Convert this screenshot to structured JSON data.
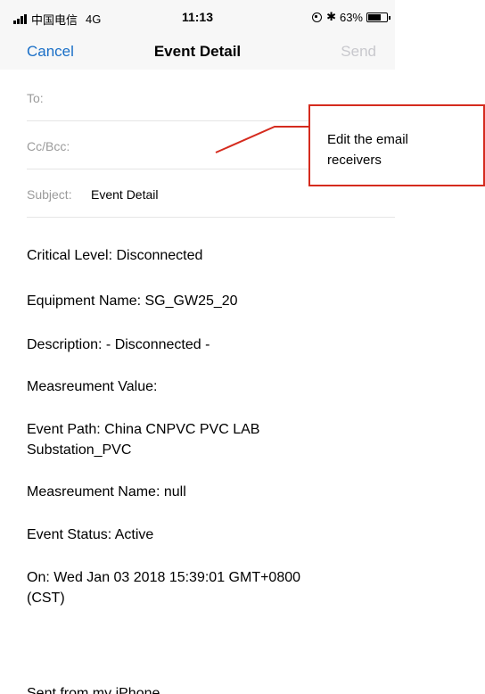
{
  "status_bar": {
    "carrier": "中国电信",
    "network": "4G",
    "time": "11:13",
    "bluetooth": "✱",
    "battery": "63%"
  },
  "nav": {
    "cancel": "Cancel",
    "title": "Event Detail",
    "send": "Send"
  },
  "fields": {
    "to_label": "To:",
    "cc_label": "Cc/Bcc:",
    "subject_label": "Subject:",
    "subject_value": "Event Detail"
  },
  "body": {
    "critical_level": "Critical Level: Disconnected",
    "equipment_name": "Equipment Name: SG_GW25_20",
    "description": "Description: - Disconnected -",
    "measurement_value": "Measreument Value:",
    "event_path_line1": "Event Path: China CNPVC PVC LAB",
    "event_path_line2": "Substation_PVC",
    "measurement_name": "Measreument Name: null",
    "event_status": "Event Status: Active",
    "on_line1": "On: Wed Jan 03 2018 15:39:01 GMT+0800",
    "on_line2": "(CST)",
    "signature": "Sent from my iPhone"
  },
  "callout": {
    "line1": "Edit the email",
    "line2": "receivers",
    "color": "#d52b1e"
  }
}
